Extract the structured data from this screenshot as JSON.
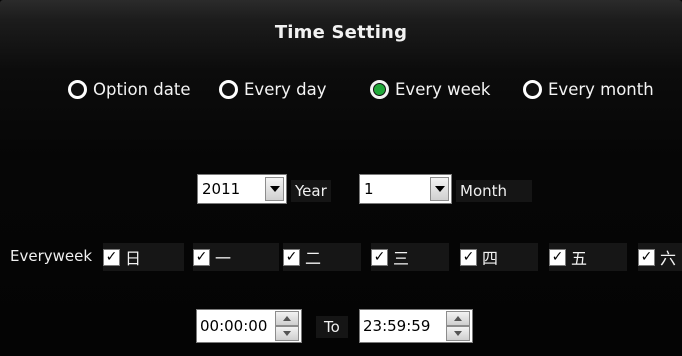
{
  "title": "Time Setting",
  "radios": [
    {
      "label": "Option date",
      "selected": false
    },
    {
      "label": "Every day",
      "selected": false
    },
    {
      "label": "Every week",
      "selected": true
    },
    {
      "label": "Every month",
      "selected": false
    }
  ],
  "year": {
    "value": "2011",
    "label": "Year"
  },
  "month": {
    "value": "1",
    "label": "Month"
  },
  "week": {
    "label": "Everyweek",
    "days": [
      {
        "label": "日",
        "checked": true
      },
      {
        "label": "一",
        "checked": true
      },
      {
        "label": "二",
        "checked": true
      },
      {
        "label": "三",
        "checked": true
      },
      {
        "label": "四",
        "checked": true
      },
      {
        "label": "五",
        "checked": true
      },
      {
        "label": "六",
        "checked": true
      }
    ]
  },
  "time": {
    "start": "00:00:00",
    "to_label": "To",
    "end": "23:59:59"
  },
  "colors": {
    "selected_dot": "#22a83a",
    "background": "#050505"
  }
}
